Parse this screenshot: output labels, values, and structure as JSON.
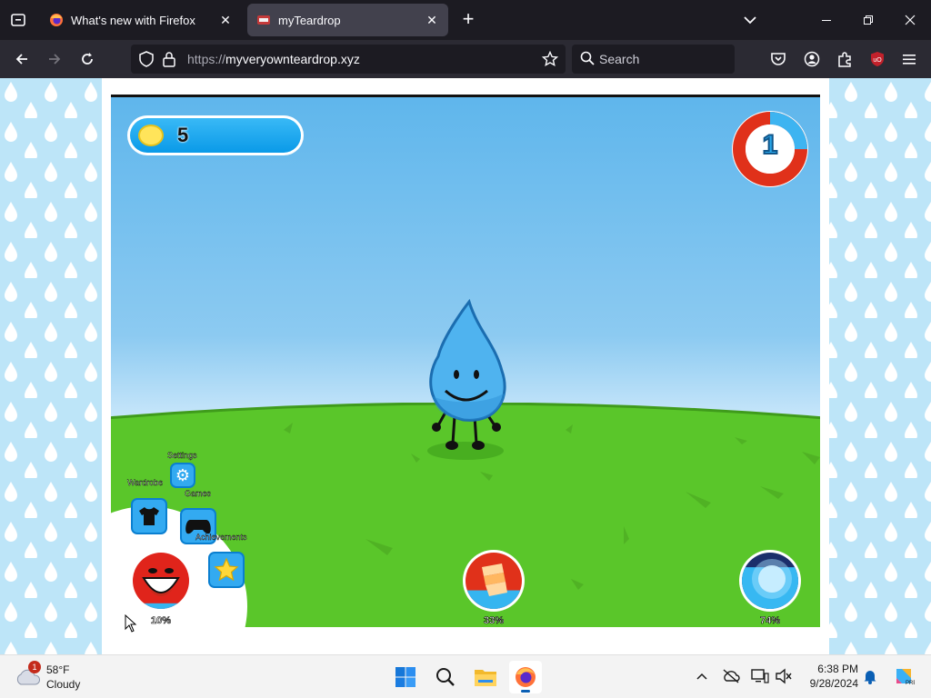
{
  "browser": {
    "tabs": [
      {
        "title": "What's new with Firefox",
        "active": false,
        "favicon": "firefox-icon"
      },
      {
        "title": "myTeardrop",
        "active": true,
        "favicon": "teardrop-favicon"
      }
    ],
    "url_protocol": "https://",
    "url_host": "myveryownteardrop.xyz",
    "search_placeholder": "Search",
    "toolbar_icons": [
      "back-icon",
      "forward-icon",
      "reload-icon",
      "pocket-icon",
      "account-icon",
      "extensions-icon",
      "ublock-icon",
      "menu-icon"
    ]
  },
  "game": {
    "coins": "5",
    "level": "1",
    "level_progress": 0.25,
    "menu": {
      "settings_label": "Settings",
      "wardrobe_label": "Wardrobe",
      "games_label": "Games",
      "achievements_label": "Achievements"
    },
    "stats": [
      {
        "name": "happiness",
        "percent_label": "10%",
        "value": 0.1
      },
      {
        "name": "food",
        "percent_label": "33%",
        "value": 0.33
      },
      {
        "name": "energy",
        "percent_label": "74%",
        "value": 0.74
      }
    ],
    "colors": {
      "sky": "#5fb6ec",
      "grass": "#5ac62a",
      "accent": "#29a7ea",
      "ring": "#e0311a"
    }
  },
  "taskbar": {
    "weather_temp": "58°F",
    "weather_condition": "Cloudy",
    "weather_badge": "1",
    "time": "6:38 PM",
    "date": "9/28/2024",
    "apps": [
      "start-icon",
      "search-icon",
      "file-explorer-icon",
      "firefox-icon"
    ]
  }
}
